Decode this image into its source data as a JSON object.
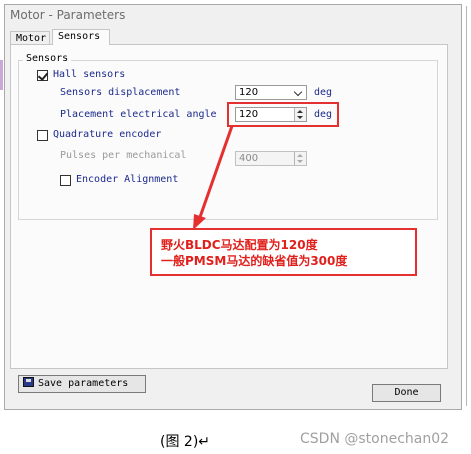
{
  "window": {
    "title": "Motor - Parameters"
  },
  "tabs": [
    {
      "label": "Motor",
      "active": false
    },
    {
      "label": "Sensors",
      "active": true
    }
  ],
  "sensors_group": {
    "label": "Sensors",
    "hall": {
      "label": "Hall sensors",
      "checked": true,
      "displacement": {
        "label": "Sensors displacement",
        "value": "120",
        "unit": "deg"
      },
      "placement": {
        "label": "Placement electrical angle",
        "value": "120",
        "unit": "deg"
      }
    },
    "quadrature": {
      "label": "Quadrature encoder",
      "checked": false,
      "pulses": {
        "label": "Pulses per mechanical",
        "value": "400"
      },
      "alignment": {
        "label": "Encoder Alignment",
        "checked": false
      }
    }
  },
  "annotation": {
    "line1": "野火BLDC马达配置为120度",
    "line2": "一般PMSM马达的缺省值为300度",
    "color": "#e53030"
  },
  "buttons": {
    "save": "Save parameters",
    "done": "Done"
  },
  "caption": "(图 2)↵",
  "watermark": "CSDN @stonechan02"
}
